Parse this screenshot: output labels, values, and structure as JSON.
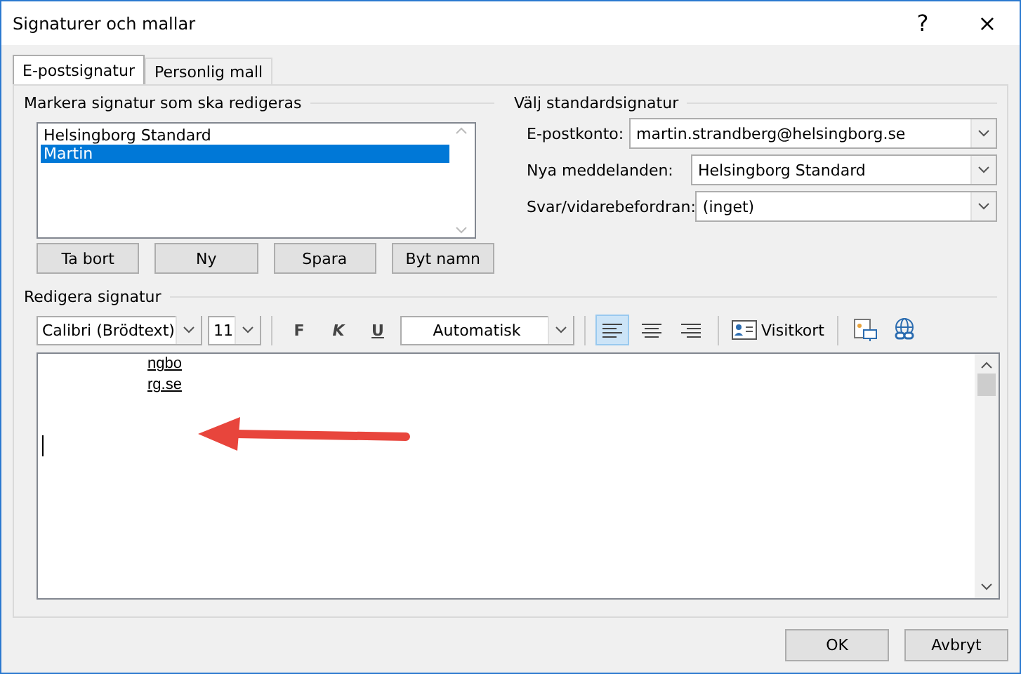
{
  "window": {
    "title": "Signaturer och mallar",
    "help": "?",
    "close": "×"
  },
  "tabs": [
    {
      "label": "E-postsignatur",
      "selected": true
    },
    {
      "label": "Personlig mall",
      "selected": false
    }
  ],
  "signature_list": {
    "label": "Markera signatur som ska redigeras",
    "items": [
      {
        "label": "Helsingborg Standard",
        "selected": false
      },
      {
        "label": "Martin",
        "selected": true
      }
    ],
    "buttons": [
      "Ta bort",
      "Ny",
      "Spara",
      "Byt namn"
    ]
  },
  "default_signature": {
    "label": "Välj standardsignatur",
    "fields": [
      {
        "label": "E-postkonto:",
        "value": "martin.strandberg@helsingborg.se"
      },
      {
        "label": "Nya meddelanden:",
        "value": "Helsingborg Standard"
      },
      {
        "label": "Svar/vidarebefordran:",
        "value": "(inget)"
      }
    ]
  },
  "editor": {
    "label": "Redigera signatur",
    "font": "Calibri (Brödtext)",
    "size": "11",
    "format_buttons": [
      {
        "label": "F",
        "kind": "bold"
      },
      {
        "label": "K",
        "kind": "italic"
      },
      {
        "label": "U",
        "kind": "underline"
      }
    ],
    "color_text": "Automatisk",
    "alignment": [
      {
        "kind": "left",
        "selected": true
      },
      {
        "kind": "center",
        "selected": false
      },
      {
        "kind": "right",
        "selected": false
      }
    ],
    "business_card": "Visitkort",
    "lines": [
      "ngbo",
      "rg.se"
    ]
  },
  "buttons": [
    "OK",
    "Avbryt"
  ]
}
